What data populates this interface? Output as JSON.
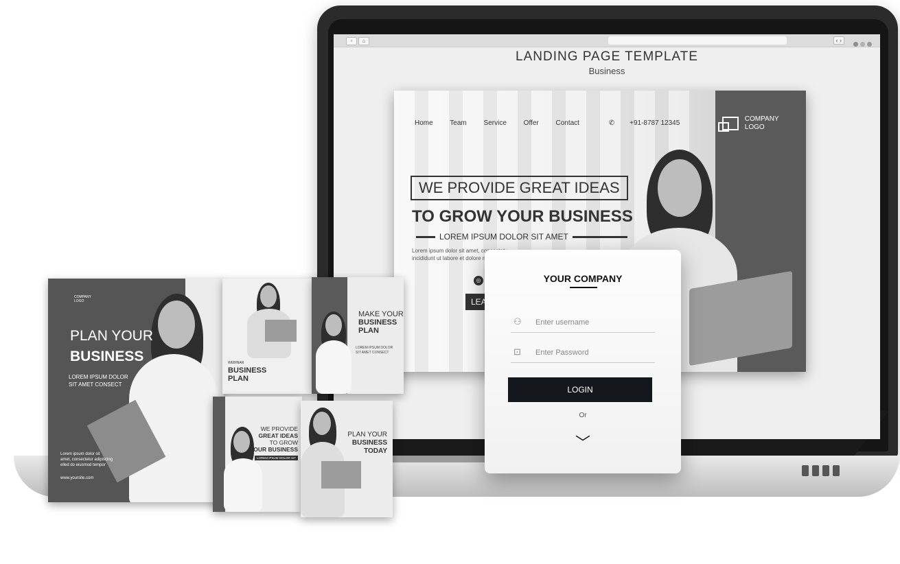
{
  "landing": {
    "title": "LANDING PAGE TEMPLATE",
    "subtitle": "Business",
    "nav": [
      "Home",
      "Team",
      "Service",
      "Offer",
      "Contact"
    ],
    "phone": "+91-8787 12345",
    "logo_line1": "COMPANY",
    "logo_line2": "LOGO",
    "headline1": "WE PROVIDE GREAT IDEAS",
    "headline2": "TO GROW YOUR BUSINESS",
    "headline3": "LOREM IPSUM DOLOR SIT AMET",
    "lorem_line1": "Lorem ipsum dolor sit amet, consectetu",
    "lorem_line2": "incididunt ut labore et dolore magna",
    "learn_button": "LEARN",
    "social_icons": [
      "instagram-icon",
      "facebook-icon"
    ]
  },
  "login": {
    "title": "YOUR COMPANY",
    "username_placeholder": "Enter username",
    "password_placeholder": "Enter Password",
    "login_button": "LOGIN",
    "or_text": "Or",
    "chevron": "chevron-down-icon"
  },
  "posters": {
    "big": {
      "logo_line1": "COMPANY",
      "logo_line2": "LOGO",
      "title_line1": "PLAN YOUR",
      "title_line2": "BUSINESS",
      "sub_line1": "LOREM IPSUM DOLOR",
      "sub_line2": "SIT AMET CONSECT",
      "body_line1": "Lorem ipsum dolor sit",
      "body_line2": "amet, consectetur adipiscing",
      "body_line3": "elled do eiusmod tempor",
      "website": "www.yoursite.com"
    },
    "webinar": {
      "label": "WEBINAR",
      "title_line1": "BUSINESS",
      "title_line2": "PLAN"
    },
    "make": {
      "title_line1": "MAKE YOUR",
      "title_line2": "BUSINESS",
      "title_line3": "PLAN",
      "sub_line1": "LOREM IPSUM DOLOR",
      "sub_line2": "SIT AMET CONSECT"
    },
    "ideas": {
      "line1": "WE PROVIDE",
      "line2": "GREAT IDEAS",
      "line3": "TO GROW",
      "line4": "YOUR BUSINESS",
      "tag": "LOREM IPSUM DOLOR SIT"
    },
    "today": {
      "line1": "PLAN YOUR",
      "line2": "BUSINESS",
      "line3": "TODAY"
    }
  },
  "colors": {
    "dark": "#14181d",
    "panel": "#5a5a5a",
    "light": "#efefef"
  }
}
